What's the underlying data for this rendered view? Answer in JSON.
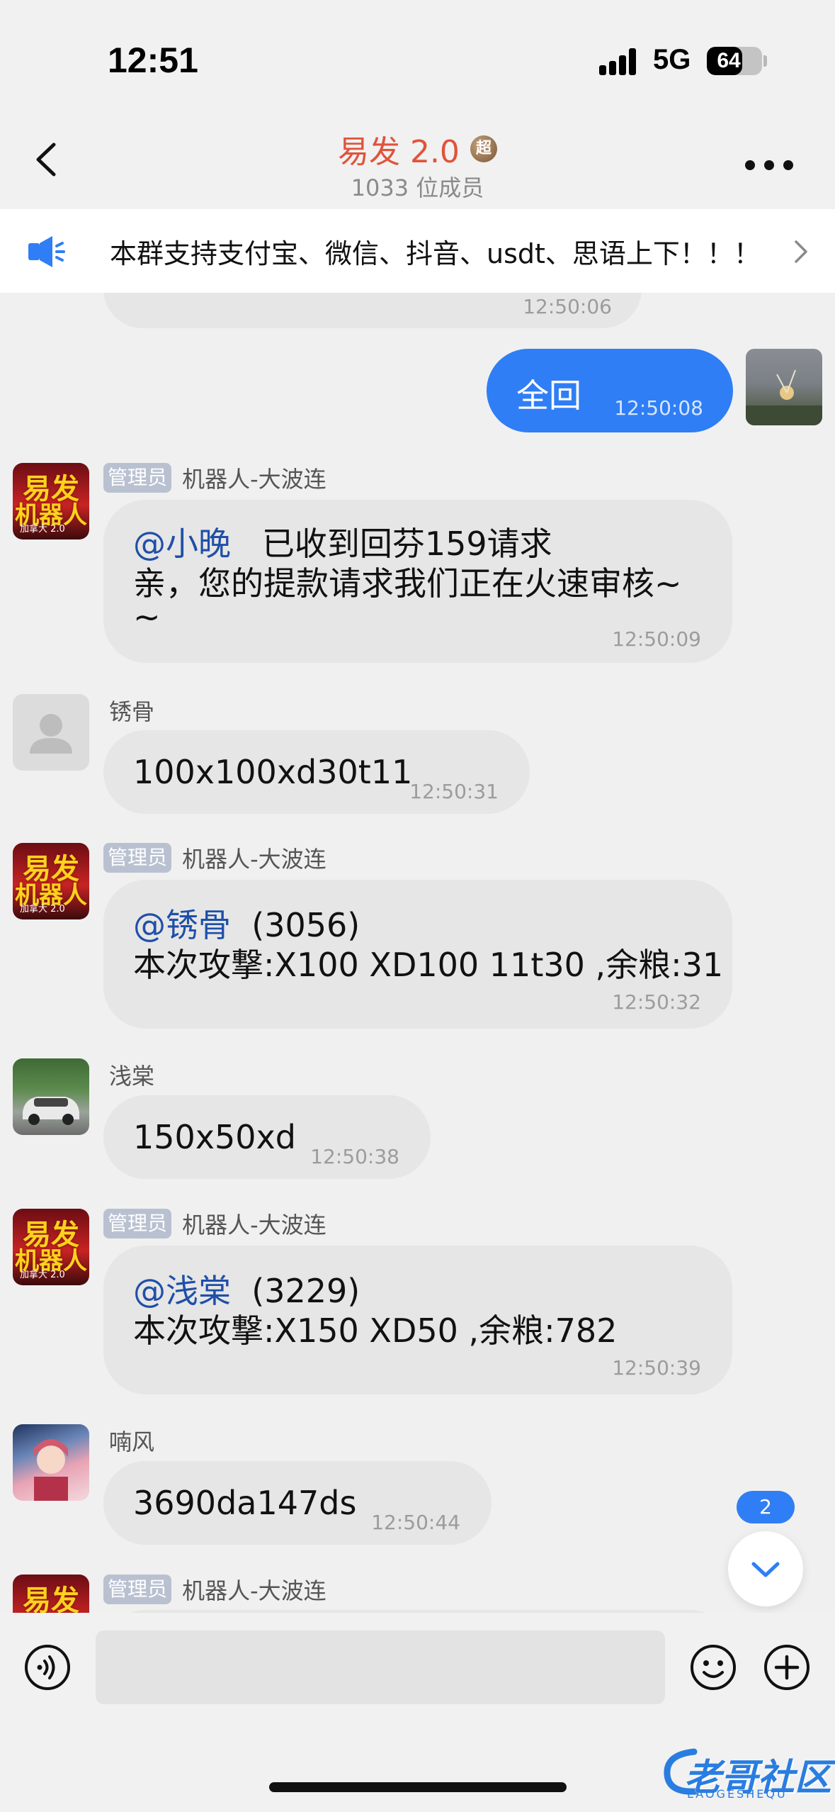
{
  "status_bar": {
    "time": "12:51",
    "network": "5G",
    "battery": "64",
    "battery_level": 0.64
  },
  "header": {
    "title": "易发 2.0",
    "badge": "超",
    "subtitle": "1033 位成员"
  },
  "notice": {
    "text": "本群支持支付宝、微信、抖音、usdt、思语上下！！！"
  },
  "messages": {
    "m0": {
      "time": "12:50:06"
    },
    "m1": {
      "text": "全回",
      "time": "12:50:08"
    },
    "m2": {
      "tag": "管理员",
      "sender": "机器人-大波连",
      "mention": "@小晚",
      "line1_rest": "已收到回芬159请求",
      "line2": "亲，您的提款请求我们正在火速审核~",
      "line3": "~",
      "time": "12:50:09"
    },
    "m3": {
      "sender": "锈骨",
      "text": "100x100xd30t11",
      "time": "12:50:31"
    },
    "m4": {
      "tag": "管理员",
      "sender": "机器人-大波连",
      "mention": "@锈骨",
      "line1_rest": "(3056)",
      "line2": "本次攻撃:X100 XD100 11t30 ,余粮:31",
      "time": "12:50:32"
    },
    "m5": {
      "sender": "浅棠",
      "text": "150x50xd",
      "time": "12:50:38"
    },
    "m6": {
      "tag": "管理员",
      "sender": "机器人-大波连",
      "mention": "@浅棠",
      "line1_rest": "(3229)",
      "line2": "本次攻撃:X150 XD50 ,余粮:782",
      "time": "12:50:39"
    },
    "m7": {
      "sender": "喃风",
      "text": "3690da147ds",
      "time": "12:50:44"
    },
    "m8": {
      "tag": "管理员",
      "sender": "机器人-大波连"
    }
  },
  "bot_avatar": {
    "line1": "易发",
    "line2": "机器人",
    "line3": "加拿大 2.0"
  },
  "unread_count": "2",
  "composer": {
    "placeholder": ""
  },
  "watermark": {
    "text": "老哥社区",
    "sub": "LAOGESHEQU"
  },
  "icons": {
    "back": "chevron-left-icon",
    "more": "more-dots-icon",
    "notice": "megaphone-icon",
    "notice_arrow": "chevron-right-icon",
    "voice": "voice-icon",
    "emoji": "smile-icon",
    "plus": "plus-circle-icon",
    "scroll": "chevron-down-icon"
  },
  "colors": {
    "accent": "#2f7ef5",
    "title": "#e0533a",
    "mention": "#1f4fa8",
    "admin_tag": "#b9c1d1"
  }
}
